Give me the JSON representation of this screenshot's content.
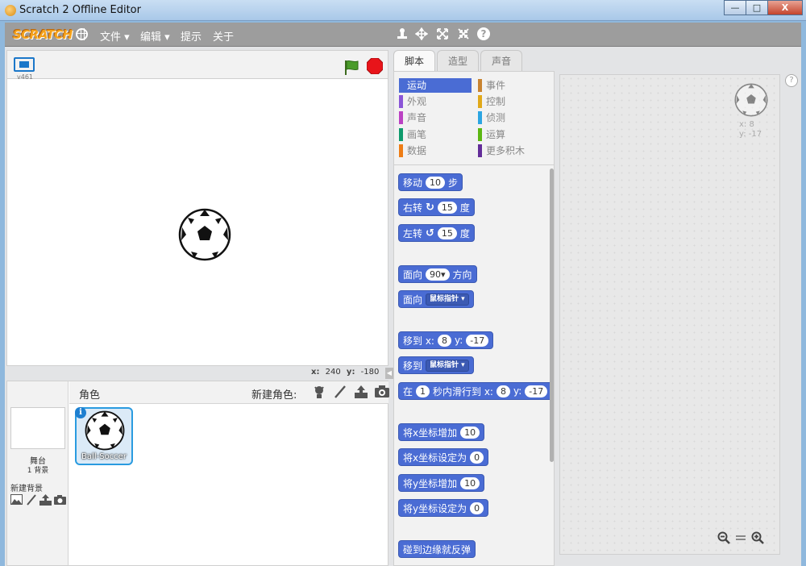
{
  "window": {
    "title": "Scratch 2 Offline Editor",
    "buttons": [
      "—",
      "□",
      "X"
    ]
  },
  "menubar": {
    "logo": "SCRATCH",
    "items": [
      "文件 ▾",
      "编辑 ▾",
      "提示",
      "关于"
    ]
  },
  "stage": {
    "version": "v461",
    "coords": {
      "x_label": "x:",
      "x_value": "240",
      "y_label": "y:",
      "y_value": "-180"
    }
  },
  "sprite_pane": {
    "title": "角色",
    "new_sprite_label": "新建角色:",
    "stage_name": "舞台",
    "stage_backdrops": "1 背景",
    "new_backdrop_label": "新建背景",
    "sprite": {
      "name": "Ball-Soccer",
      "info": "i"
    }
  },
  "tabs": [
    "脚本",
    "造型",
    "声音"
  ],
  "categories": [
    {
      "label": "运动",
      "color": "#4a6cd4"
    },
    {
      "label": "事件",
      "color": "#c88330"
    },
    {
      "label": "外观",
      "color": "#8a55d7"
    },
    {
      "label": "控制",
      "color": "#e1a91a"
    },
    {
      "label": "声音",
      "color": "#bb42c3"
    },
    {
      "label": "侦测",
      "color": "#2ca5e2"
    },
    {
      "label": "画笔",
      "color": "#0e9a6c"
    },
    {
      "label": "运算",
      "color": "#5cb712"
    },
    {
      "label": "数据",
      "color": "#ee7d16"
    },
    {
      "label": "更多积木",
      "color": "#632d99"
    }
  ],
  "blocks": {
    "move": {
      "a": "移动",
      "v": "10",
      "b": "步"
    },
    "turn_right": {
      "a": "右转",
      "v": "15",
      "b": "度"
    },
    "turn_left": {
      "a": "左转",
      "v": "15",
      "b": "度"
    },
    "point_dir": {
      "a": "面向",
      "v": "90▾",
      "b": "方向"
    },
    "point_towards": {
      "a": "面向",
      "v": "鼠标指针 ▾"
    },
    "goto_xy": {
      "a": "移到 x:",
      "x": "8",
      "b": "y:",
      "y": "-17"
    },
    "goto": {
      "a": "移到",
      "v": "鼠标指针 ▾"
    },
    "glide": {
      "a": "在",
      "secs": "1",
      "b": "秒内滑行到 x:",
      "x": "8",
      "c": "y:",
      "y": "-17"
    },
    "change_x": {
      "a": "将x坐标增加",
      "v": "10"
    },
    "set_x": {
      "a": "将x坐标设定为",
      "v": "0"
    },
    "change_y": {
      "a": "将y坐标增加",
      "v": "10"
    },
    "set_y": {
      "a": "将y坐标设定为",
      "v": "0"
    },
    "bounce": {
      "a": "碰到边缘就反弹"
    }
  },
  "scripts": {
    "x": "x: 8",
    "y": "y: -17"
  },
  "colors": {
    "motion": "#4a6cd4",
    "accent": "#2a9be0",
    "menubar": "#9d9d9d"
  }
}
